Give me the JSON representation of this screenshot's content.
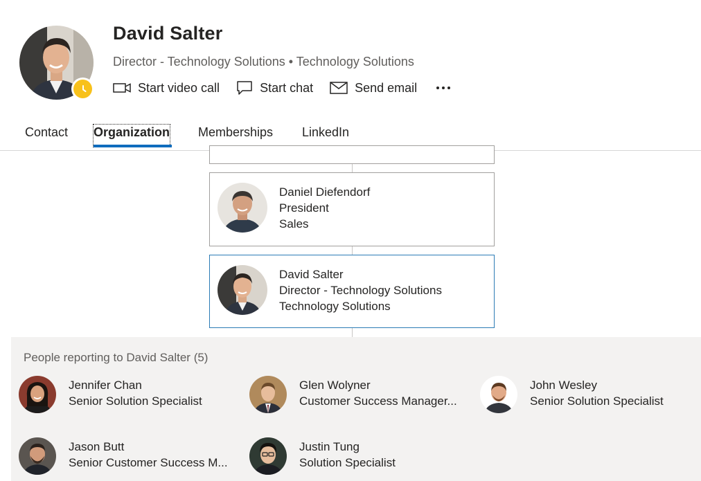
{
  "profile": {
    "name": "David Salter",
    "subtitle": "Director - Technology Solutions • Technology Solutions",
    "presence_color": "#f8c11b"
  },
  "actions": {
    "video_call": "Start video call",
    "chat": "Start chat",
    "email": "Send email"
  },
  "tabs": [
    {
      "label": "Contact"
    },
    {
      "label": "Organization"
    },
    {
      "label": "Memberships"
    },
    {
      "label": "LinkedIn"
    }
  ],
  "org_chain": [
    {
      "name": "Daniel Diefendorf",
      "title": "President",
      "department": "Sales"
    },
    {
      "name": "David Salter",
      "title": "Director - Technology Solutions",
      "department": "Technology Solutions"
    }
  ],
  "reports": {
    "heading": "People reporting to David Salter (5)",
    "people": [
      {
        "name": "Jennifer Chan",
        "title": "Senior Solution Specialist"
      },
      {
        "name": "Glen Wolyner",
        "title": "Customer Success Manager..."
      },
      {
        "name": "John Wesley",
        "title": "Senior Solution Specialist"
      },
      {
        "name": "Jason Butt",
        "title": "Senior Customer Success M..."
      },
      {
        "name": "Justin Tung",
        "title": "Solution Specialist"
      }
    ]
  },
  "colors": {
    "accent": "#0f6cbd",
    "current_card_border": "#2b7bb5",
    "reports_background": "#f3f2f1"
  }
}
